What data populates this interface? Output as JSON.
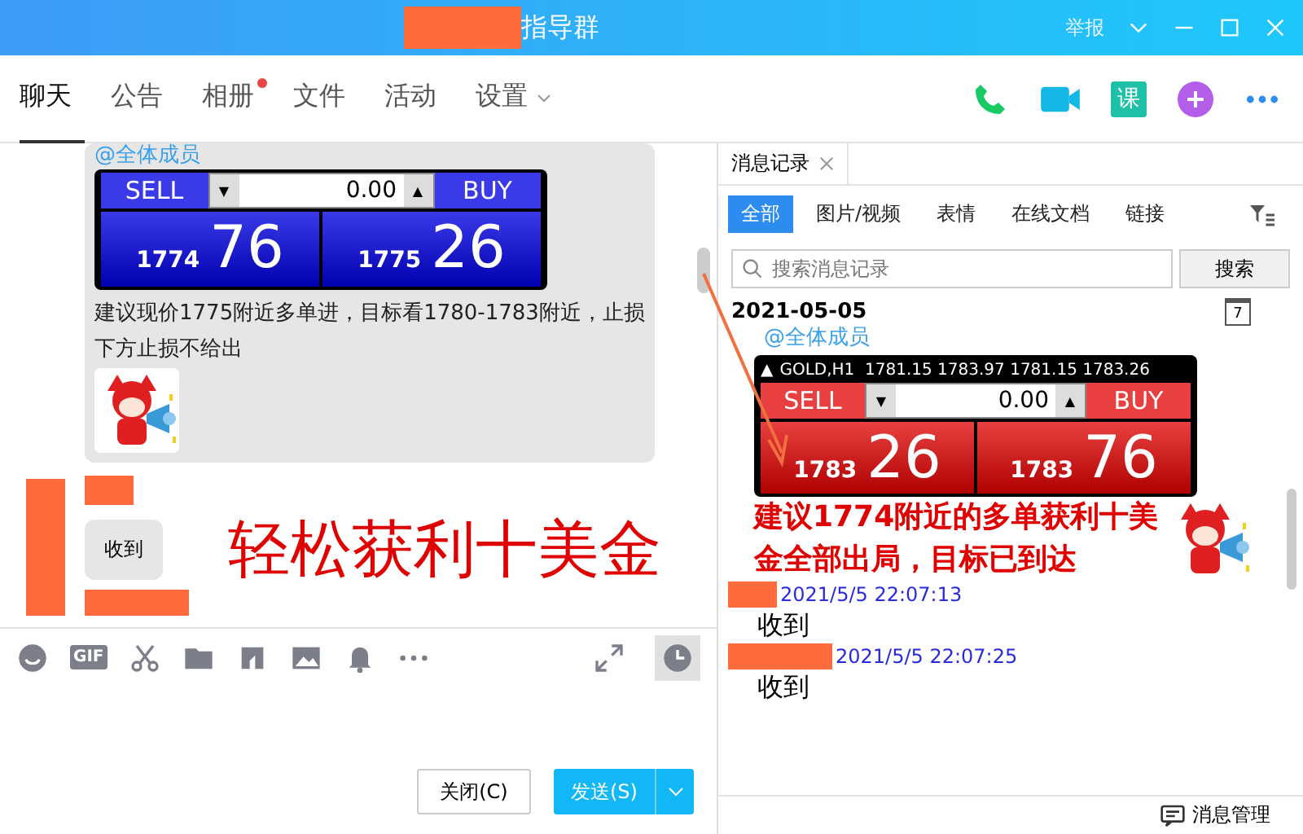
{
  "window": {
    "title": "指导群",
    "report": "举报"
  },
  "tabs": [
    {
      "label": "聊天",
      "selected": true,
      "unread": false,
      "dropdown": false
    },
    {
      "label": "公告",
      "selected": false,
      "unread": false,
      "dropdown": false
    },
    {
      "label": "相册",
      "selected": false,
      "unread": true,
      "dropdown": false
    },
    {
      "label": "文件",
      "selected": false,
      "unread": false,
      "dropdown": false
    },
    {
      "label": "活动",
      "selected": false,
      "unread": false,
      "dropdown": false
    },
    {
      "label": "设置",
      "selected": false,
      "unread": false,
      "dropdown": true
    }
  ],
  "course_icon": "课",
  "chat": {
    "post": {
      "mention": "@全体成员",
      "widget": {
        "kind": "blue",
        "sell": "SELL",
        "buy": "BUY",
        "lot": "0.00",
        "down": "▼",
        "up": "▲",
        "bid_small": "1774",
        "bid_big": "76",
        "ask_small": "1775",
        "ask_big": "26"
      },
      "text": "建议现价1775附近多单进，目标看1780-1783附近，止损下方止损不给出"
    },
    "reply": "收到",
    "caption": "轻松获利十美金"
  },
  "composer": {
    "gif": "GIF",
    "close": "关闭(C)",
    "send": "发送(S)"
  },
  "history": {
    "tab": "消息记录",
    "filters": [
      {
        "label": "全部",
        "selected": true
      },
      {
        "label": "图片/视频",
        "selected": false
      },
      {
        "label": "表情",
        "selected": false
      },
      {
        "label": "在线文档",
        "selected": false
      },
      {
        "label": "链接",
        "selected": false
      }
    ],
    "search_placeholder": "搜索消息记录",
    "search_button": "搜索",
    "date": "2021-05-05",
    "calendar_day": "7",
    "post": {
      "mention": "@全体成员",
      "widget": {
        "kind": "red",
        "header": "GOLD,H1  1781.15 1783.97 1781.15 1783.26",
        "header_mark": "▲",
        "sell": "SELL",
        "buy": "BUY",
        "lot": "0.00",
        "down": "▼",
        "up": "▲",
        "bid_small": "1783",
        "bid_big": "26",
        "ask_small": "1783",
        "ask_big": "76"
      },
      "text": "建议1774附近的多单获利十美金全部出局，目标已到达"
    },
    "messages": [
      {
        "time": "2021/5/5 22:07:13",
        "text": "收到"
      },
      {
        "time": "2021/5/5 22:07:25",
        "text": "收到"
      }
    ],
    "manage": "消息管理"
  }
}
